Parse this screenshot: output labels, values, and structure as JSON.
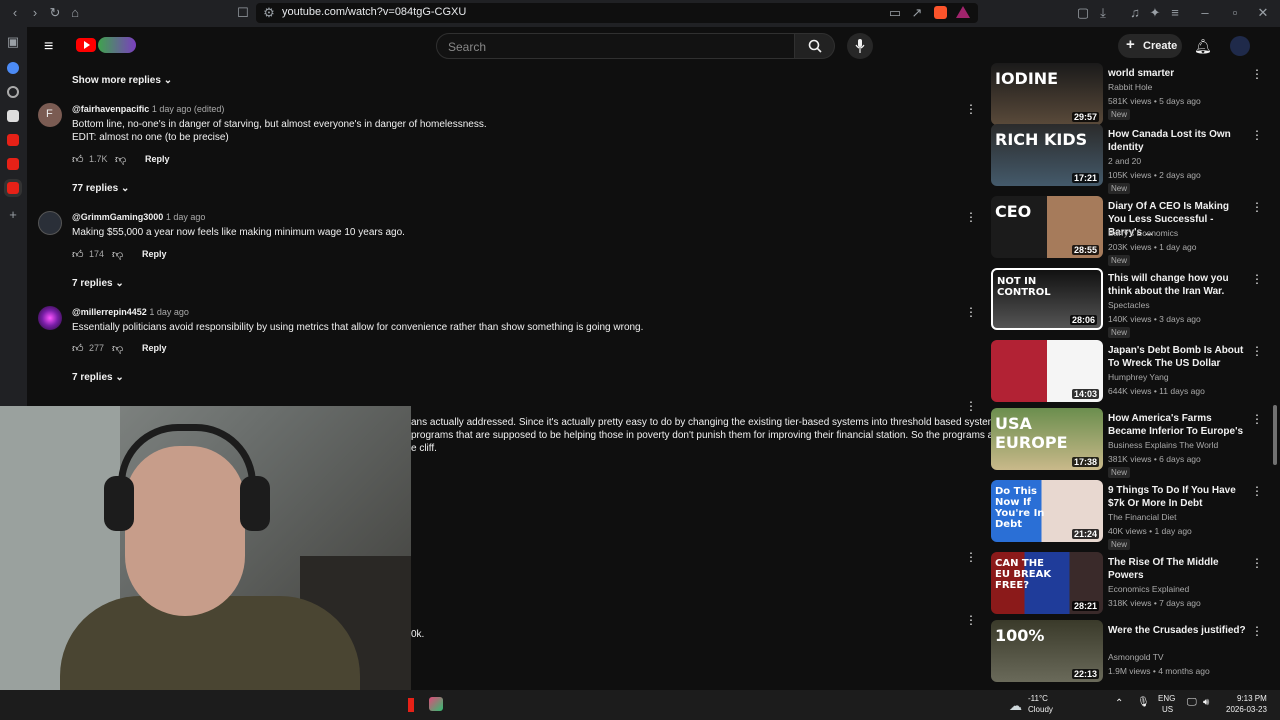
{
  "browser": {
    "url": "youtube.com/watch?v=084tgG-CGXU"
  },
  "header": {
    "search_placeholder": "Search",
    "create_label": "Create"
  },
  "comments": [
    {
      "show_more": "Show more replies",
      "handle": "@fairhavenpacific",
      "time": "1 day ago (edited)",
      "avatar_letter": "F",
      "text1": "Bottom line, no-one's in danger of starving, but almost everyone's in danger of homelessness.",
      "text2": "EDIT: almost no one (to be precise)",
      "likes": "1.7K",
      "reply": "Reply",
      "replies": "77 replies"
    },
    {
      "handle": "@GrimmGaming3000",
      "time": "1 day ago",
      "text1": "Making $55,000 a year now feels like making minimum wage 10 years ago.",
      "likes": "174",
      "reply": "Reply",
      "replies": "7 replies"
    },
    {
      "handle": "@millerrepin4452",
      "time": "1 day ago",
      "text1": "Essentially politicians avoid responsibility by using metrics that allow for convenience rather than show something is going wrong.",
      "likes": "277",
      "reply": "Reply",
      "replies": "7 replies"
    },
    {
      "partial1": "ans actually addressed. Since it's actually pretty easy to do by changing the existing tier-based systems into threshold based systems",
      "partial2": "programs that are supposed to be helping those in poverty don't punish them for improving their financial station. So the programs are",
      "partial3": "e cliff.",
      "partial4": "0k."
    }
  ],
  "sidebar": [
    {
      "thumb_text": "IODINE",
      "duration": "29:57",
      "title": "world smarter",
      "channel": "Rabbit Hole",
      "meta": "581K views • 5 days ago",
      "badge": "New"
    },
    {
      "thumb_text": "RICH KIDS",
      "duration": "17:21",
      "title": "How Canada Lost its Own Identity",
      "channel": "2 and 20",
      "meta": "105K views • 2 days ago",
      "badge": "New"
    },
    {
      "thumb_text": "CEO",
      "duration": "28:55",
      "title": "Diary Of A CEO Is Making You Less Successful - Barry's ...",
      "channel": "Barry's Economics",
      "meta": "203K views • 1 day ago",
      "badge": "New"
    },
    {
      "thumb_text": "NOT IN CONTROL",
      "duration": "28:06",
      "title": "This will change how you think about the Iran War.",
      "channel": "Spectacles",
      "meta": "140K views • 3 days ago",
      "badge": "New"
    },
    {
      "thumb_text": "",
      "duration": "14:03",
      "title": "Japan's Debt Bomb Is About To Wreck The US Dollar",
      "channel": "Humphrey Yang",
      "meta": "644K views • 11 days ago",
      "badge": ""
    },
    {
      "thumb_text": "USA  EUROPE",
      "duration": "17:38",
      "title": "How America's Farms Became Inferior To Europe's",
      "channel": "Business Explains The World",
      "meta": "381K views • 6 days ago",
      "badge": "New"
    },
    {
      "thumb_text": "Do This Now If You're In Debt",
      "duration": "21:24",
      "title": "9 Things To Do If You Have $7k Or More In Debt",
      "channel": "The Financial Diet",
      "meta": "40K views • 1 day ago",
      "badge": "New"
    },
    {
      "thumb_text": "CAN THE EU BREAK FREE?",
      "duration": "28:21",
      "title": "The Rise Of The Middle Powers",
      "channel": "Economics Explained",
      "meta": "318K views • 7 days ago",
      "badge": ""
    },
    {
      "thumb_text": "100%",
      "duration": "22:13",
      "title": "Were the Crusades justified?",
      "channel": "Asmongold TV",
      "meta": "1.9M views • 4 months ago",
      "badge": ""
    }
  ],
  "taskbar": {
    "weather_temp": "-11°C",
    "weather_desc": "Cloudy",
    "lang1": "ENG",
    "lang2": "US",
    "time": "9:13 PM",
    "date": "2026-03-23"
  },
  "colors": {
    "accent_red": "#ff0000",
    "bg": "#0f0f0f"
  }
}
